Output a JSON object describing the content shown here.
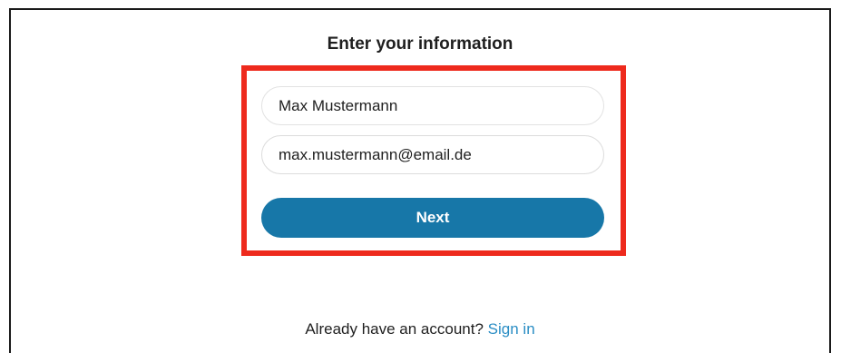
{
  "form": {
    "title": "Enter your information",
    "name_value": "Max Mustermann",
    "email_value": "max.mustermann@email.de",
    "next_label": "Next"
  },
  "footer": {
    "prompt": "Already have an account?",
    "signin_label": "Sign in"
  },
  "colors": {
    "accent": "#1777a8",
    "link": "#2a8dc4",
    "highlight": "#ee2a1d"
  }
}
